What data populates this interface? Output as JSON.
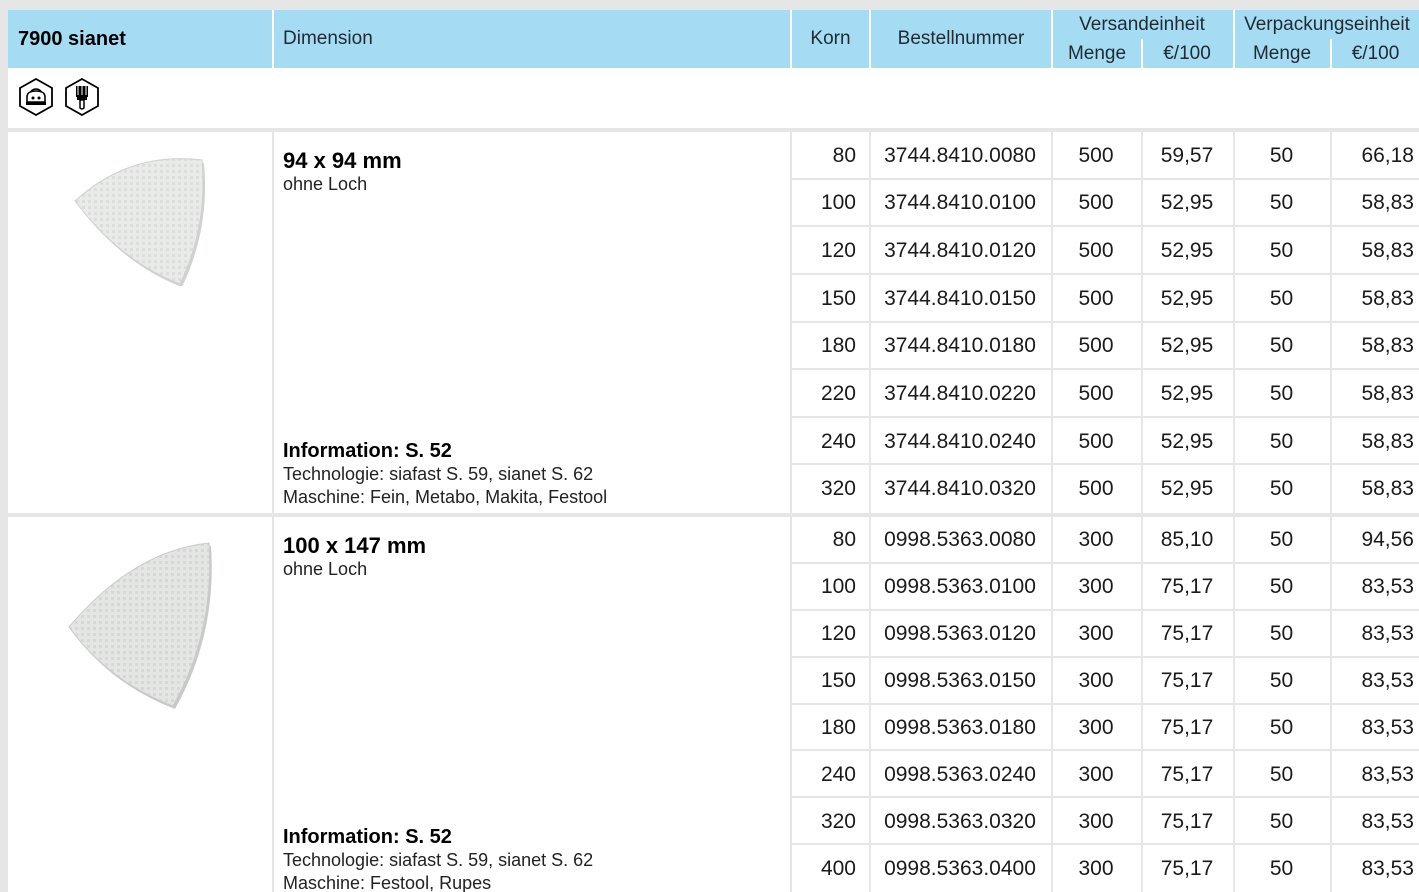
{
  "header": {
    "title": "7900 sianet",
    "dimension": "Dimension",
    "korn": "Korn",
    "bestellnummer": "Bestellnummer",
    "versandeinheit": "Versandeinheit",
    "verpackungseinheit": "Verpackungseinheit",
    "menge": "Menge",
    "price": "€/100"
  },
  "icons": [
    "sander-machine-icon",
    "brush-icon"
  ],
  "products": [
    {
      "dimension": "94 x 94 mm",
      "subtitle": "ohne Loch",
      "info_title": "Information: S. 52",
      "technologie": "Technologie: siafast S. 59, sianet S. 62",
      "maschine": "Maschine: Fein, Metabo, Makita, Festool",
      "rows": [
        {
          "korn": "80",
          "nr": "3744.8410.0080",
          "v_menge": "500",
          "v_price": "59,57",
          "p_menge": "50",
          "p_price": "66,18"
        },
        {
          "korn": "100",
          "nr": "3744.8410.0100",
          "v_menge": "500",
          "v_price": "52,95",
          "p_menge": "50",
          "p_price": "58,83"
        },
        {
          "korn": "120",
          "nr": "3744.8410.0120",
          "v_menge": "500",
          "v_price": "52,95",
          "p_menge": "50",
          "p_price": "58,83"
        },
        {
          "korn": "150",
          "nr": "3744.8410.0150",
          "v_menge": "500",
          "v_price": "52,95",
          "p_menge": "50",
          "p_price": "58,83"
        },
        {
          "korn": "180",
          "nr": "3744.8410.0180",
          "v_menge": "500",
          "v_price": "52,95",
          "p_menge": "50",
          "p_price": "58,83"
        },
        {
          "korn": "220",
          "nr": "3744.8410.0220",
          "v_menge": "500",
          "v_price": "52,95",
          "p_menge": "50",
          "p_price": "58,83"
        },
        {
          "korn": "240",
          "nr": "3744.8410.0240",
          "v_menge": "500",
          "v_price": "52,95",
          "p_menge": "50",
          "p_price": "58,83"
        },
        {
          "korn": "320",
          "nr": "3744.8410.0320",
          "v_menge": "500",
          "v_price": "52,95",
          "p_menge": "50",
          "p_price": "58,83"
        }
      ]
    },
    {
      "dimension": "100 x 147 mm",
      "subtitle": "ohne Loch",
      "info_title": "Information: S. 52",
      "technologie": "Technologie: siafast S. 59, sianet S. 62",
      "maschine": "Maschine: Festool, Rupes",
      "rows": [
        {
          "korn": "80",
          "nr": "0998.5363.0080",
          "v_menge": "300",
          "v_price": "85,10",
          "p_menge": "50",
          "p_price": "94,56"
        },
        {
          "korn": "100",
          "nr": "0998.5363.0100",
          "v_menge": "300",
          "v_price": "75,17",
          "p_menge": "50",
          "p_price": "83,53"
        },
        {
          "korn": "120",
          "nr": "0998.5363.0120",
          "v_menge": "300",
          "v_price": "75,17",
          "p_menge": "50",
          "p_price": "83,53"
        },
        {
          "korn": "150",
          "nr": "0998.5363.0150",
          "v_menge": "300",
          "v_price": "75,17",
          "p_menge": "50",
          "p_price": "83,53"
        },
        {
          "korn": "180",
          "nr": "0998.5363.0180",
          "v_menge": "300",
          "v_price": "75,17",
          "p_menge": "50",
          "p_price": "83,53"
        },
        {
          "korn": "240",
          "nr": "0998.5363.0240",
          "v_menge": "300",
          "v_price": "75,17",
          "p_menge": "50",
          "p_price": "83,53"
        },
        {
          "korn": "320",
          "nr": "0998.5363.0320",
          "v_menge": "300",
          "v_price": "75,17",
          "p_menge": "50",
          "p_price": "83,53"
        },
        {
          "korn": "400",
          "nr": "0998.5363.0400",
          "v_menge": "300",
          "v_price": "75,17",
          "p_menge": "50",
          "p_price": "83,53"
        }
      ]
    }
  ]
}
